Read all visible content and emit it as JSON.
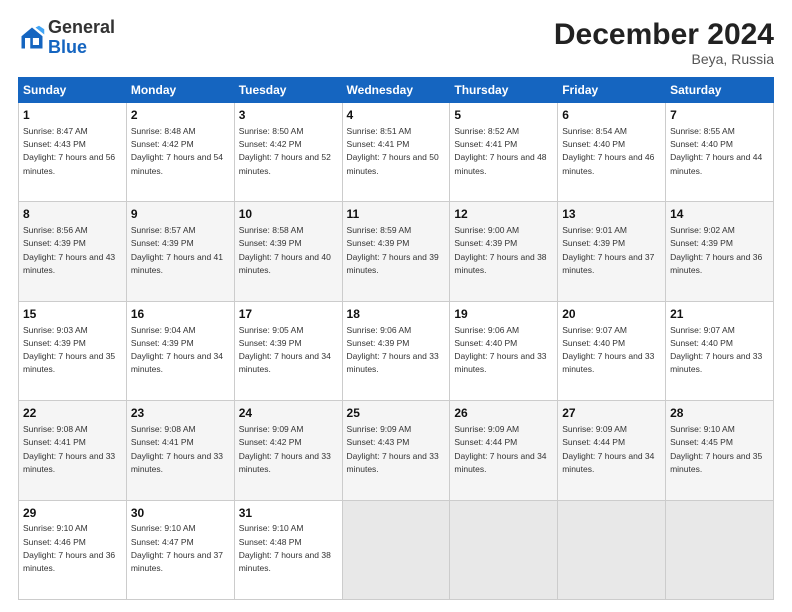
{
  "header": {
    "logo_line1": "General",
    "logo_line2": "Blue",
    "title": "December 2024",
    "subtitle": "Beya, Russia"
  },
  "days_of_week": [
    "Sunday",
    "Monday",
    "Tuesday",
    "Wednesday",
    "Thursday",
    "Friday",
    "Saturday"
  ],
  "weeks": [
    [
      {
        "day": "1",
        "sunrise": "8:47 AM",
        "sunset": "4:43 PM",
        "daylight": "7 hours and 56 minutes."
      },
      {
        "day": "2",
        "sunrise": "8:48 AM",
        "sunset": "4:42 PM",
        "daylight": "7 hours and 54 minutes."
      },
      {
        "day": "3",
        "sunrise": "8:50 AM",
        "sunset": "4:42 PM",
        "daylight": "7 hours and 52 minutes."
      },
      {
        "day": "4",
        "sunrise": "8:51 AM",
        "sunset": "4:41 PM",
        "daylight": "7 hours and 50 minutes."
      },
      {
        "day": "5",
        "sunrise": "8:52 AM",
        "sunset": "4:41 PM",
        "daylight": "7 hours and 48 minutes."
      },
      {
        "day": "6",
        "sunrise": "8:54 AM",
        "sunset": "4:40 PM",
        "daylight": "7 hours and 46 minutes."
      },
      {
        "day": "7",
        "sunrise": "8:55 AM",
        "sunset": "4:40 PM",
        "daylight": "7 hours and 44 minutes."
      }
    ],
    [
      {
        "day": "8",
        "sunrise": "8:56 AM",
        "sunset": "4:39 PM",
        "daylight": "7 hours and 43 minutes."
      },
      {
        "day": "9",
        "sunrise": "8:57 AM",
        "sunset": "4:39 PM",
        "daylight": "7 hours and 41 minutes."
      },
      {
        "day": "10",
        "sunrise": "8:58 AM",
        "sunset": "4:39 PM",
        "daylight": "7 hours and 40 minutes."
      },
      {
        "day": "11",
        "sunrise": "8:59 AM",
        "sunset": "4:39 PM",
        "daylight": "7 hours and 39 minutes."
      },
      {
        "day": "12",
        "sunrise": "9:00 AM",
        "sunset": "4:39 PM",
        "daylight": "7 hours and 38 minutes."
      },
      {
        "day": "13",
        "sunrise": "9:01 AM",
        "sunset": "4:39 PM",
        "daylight": "7 hours and 37 minutes."
      },
      {
        "day": "14",
        "sunrise": "9:02 AM",
        "sunset": "4:39 PM",
        "daylight": "7 hours and 36 minutes."
      }
    ],
    [
      {
        "day": "15",
        "sunrise": "9:03 AM",
        "sunset": "4:39 PM",
        "daylight": "7 hours and 35 minutes."
      },
      {
        "day": "16",
        "sunrise": "9:04 AM",
        "sunset": "4:39 PM",
        "daylight": "7 hours and 34 minutes."
      },
      {
        "day": "17",
        "sunrise": "9:05 AM",
        "sunset": "4:39 PM",
        "daylight": "7 hours and 34 minutes."
      },
      {
        "day": "18",
        "sunrise": "9:06 AM",
        "sunset": "4:39 PM",
        "daylight": "7 hours and 33 minutes."
      },
      {
        "day": "19",
        "sunrise": "9:06 AM",
        "sunset": "4:40 PM",
        "daylight": "7 hours and 33 minutes."
      },
      {
        "day": "20",
        "sunrise": "9:07 AM",
        "sunset": "4:40 PM",
        "daylight": "7 hours and 33 minutes."
      },
      {
        "day": "21",
        "sunrise": "9:07 AM",
        "sunset": "4:40 PM",
        "daylight": "7 hours and 33 minutes."
      }
    ],
    [
      {
        "day": "22",
        "sunrise": "9:08 AM",
        "sunset": "4:41 PM",
        "daylight": "7 hours and 33 minutes."
      },
      {
        "day": "23",
        "sunrise": "9:08 AM",
        "sunset": "4:41 PM",
        "daylight": "7 hours and 33 minutes."
      },
      {
        "day": "24",
        "sunrise": "9:09 AM",
        "sunset": "4:42 PM",
        "daylight": "7 hours and 33 minutes."
      },
      {
        "day": "25",
        "sunrise": "9:09 AM",
        "sunset": "4:43 PM",
        "daylight": "7 hours and 33 minutes."
      },
      {
        "day": "26",
        "sunrise": "9:09 AM",
        "sunset": "4:44 PM",
        "daylight": "7 hours and 34 minutes."
      },
      {
        "day": "27",
        "sunrise": "9:09 AM",
        "sunset": "4:44 PM",
        "daylight": "7 hours and 34 minutes."
      },
      {
        "day": "28",
        "sunrise": "9:10 AM",
        "sunset": "4:45 PM",
        "daylight": "7 hours and 35 minutes."
      }
    ],
    [
      {
        "day": "29",
        "sunrise": "9:10 AM",
        "sunset": "4:46 PM",
        "daylight": "7 hours and 36 minutes."
      },
      {
        "day": "30",
        "sunrise": "9:10 AM",
        "sunset": "4:47 PM",
        "daylight": "7 hours and 37 minutes."
      },
      {
        "day": "31",
        "sunrise": "9:10 AM",
        "sunset": "4:48 PM",
        "daylight": "7 hours and 38 minutes."
      },
      null,
      null,
      null,
      null
    ]
  ]
}
